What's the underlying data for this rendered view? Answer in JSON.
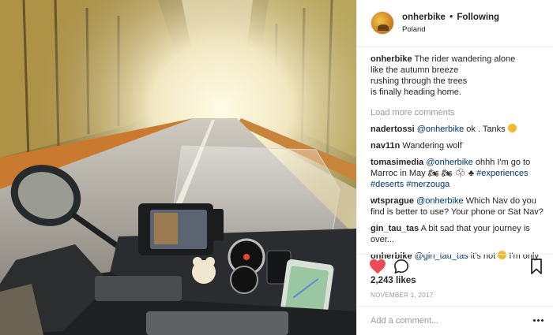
{
  "post": {
    "username": "onherbike",
    "follow_state": "Following",
    "separator": "•",
    "location": "Poland"
  },
  "caption": {
    "username": "onherbike",
    "lines": [
      "The rider wandering alone",
      "like the autumn breeze",
      "rushing through the trees",
      "is finally heading home."
    ]
  },
  "load_more_label": "Load more comments",
  "comments": [
    {
      "user": "nadertossi",
      "mention": "@onherbike",
      "text": " ok . Tanks",
      "emoji": "grinning-face"
    },
    {
      "user": "nav11n",
      "text": "Wandering wolf"
    },
    {
      "user": "tomasimedia",
      "mention": "@onherbike",
      "text": " ohhh I'm go to Marroc in May ",
      "tags": [
        "#experiences",
        "#deserts",
        "#merzouga"
      ]
    },
    {
      "user": "wtsprague",
      "mention": "@onherbike",
      "text": " Which Nav do you find is better to use? Your phone or Sat Nav?"
    },
    {
      "user": "gin_tau_tas",
      "text": "A bit sad that your journey is over..."
    },
    {
      "user": "onherbike",
      "mention": "@gin_tau_tas",
      "text": " it's not",
      "tail": "  I'm only",
      "emoji": "smiling-face"
    }
  ],
  "likes": "2,243 likes",
  "date": "NOVEMBER 1, 2017",
  "add_comment_placeholder": "Add a comment...",
  "colors": {
    "like_red": "#ed4956",
    "link_blue": "#003569",
    "muted_gray": "#999999",
    "text": "#262626",
    "divider": "#efefef"
  },
  "icons": {
    "like": "heart-icon",
    "comment": "speech-bubble-icon",
    "save": "bookmark-icon",
    "more": "more-options-icon"
  }
}
